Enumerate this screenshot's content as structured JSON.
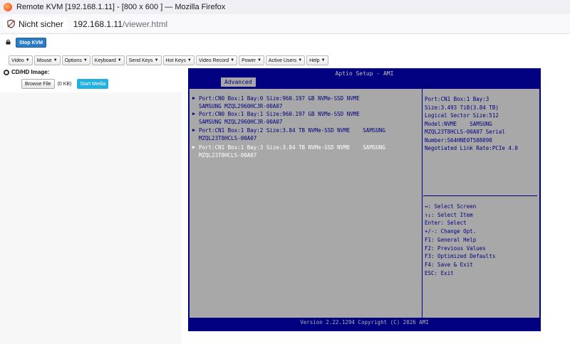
{
  "window": {
    "title": "Remote KVM [192.168.1.11] - [800 x 600 ] — Mozilla Firefox"
  },
  "urlbar": {
    "security_label": "Nicht sicher",
    "host": "192.168.1.11",
    "path": "/viewer.html"
  },
  "toolbar": {
    "stop_label": "Stop KVM",
    "menus": [
      {
        "label": "Video"
      },
      {
        "label": "Mouse"
      },
      {
        "label": "Options"
      },
      {
        "label": "Keyboard"
      },
      {
        "label": "Send Keys"
      },
      {
        "label": "Hot Keys"
      },
      {
        "label": "Video Record"
      },
      {
        "label": "Power"
      },
      {
        "label": "Active Users"
      },
      {
        "label": "Help"
      }
    ]
  },
  "media": {
    "section_label": "CD/HD Image:",
    "browse_label": "Browse File",
    "size_label": "(0 KB)",
    "start_label": "Start Media"
  },
  "bios": {
    "title": "Aptio Setup - AMI",
    "tab": "Advanced",
    "ports": [
      {
        "line1": "Port:CN0 Box:1 Bay:0 Size:960.197 GB NVMe-SSD NVME",
        "line2": "SAMSUNG MZQL2960HCJR-00A07",
        "selected": false
      },
      {
        "line1": "Port:CN0 Box:1 Bay:1 Size:960.197 GB NVMe-SSD NVME",
        "line2": "SAMSUNG MZQL2960HCJR-00A07",
        "selected": false
      },
      {
        "line1": "Port:CN1 Box:1 Bay:2 Size:3.84 TB NVMe-SSD NVME    SAMSUNG",
        "line2": "MZQL23T8HCLS-00A07",
        "selected": false
      },
      {
        "line1": "Port:CN1 Box:1 Bay:3 Size:3.84 TB NVMe-SSD NVME    SAMSUNG",
        "line2": "MZQL23T8HCLS-00A07",
        "selected": true
      }
    ],
    "help_lines": [
      "Port:CN1 Box:1 Bay:3",
      "Size:3.493 TiB(3.84 TB)",
      "Logical Sector Size:512",
      "Model:NVME    SAMSUNG",
      "MZQL23T8HCLS-00A07 Serial",
      "Number:S64HNE0T508090",
      "Negotiated Link Rate:PCIe 4.0"
    ],
    "keys": [
      "↔: Select Screen",
      "↑↓: Select Item",
      "Enter: Select",
      "+/-: Change Opt.",
      "F1: General Help",
      "F2: Previous Values",
      "F3: Optimized Defaults",
      "F4: Save & Exit",
      "ESC: Exit"
    ],
    "footer": "Version 2.22.1294 Copyright (C) 2026 AMI"
  }
}
